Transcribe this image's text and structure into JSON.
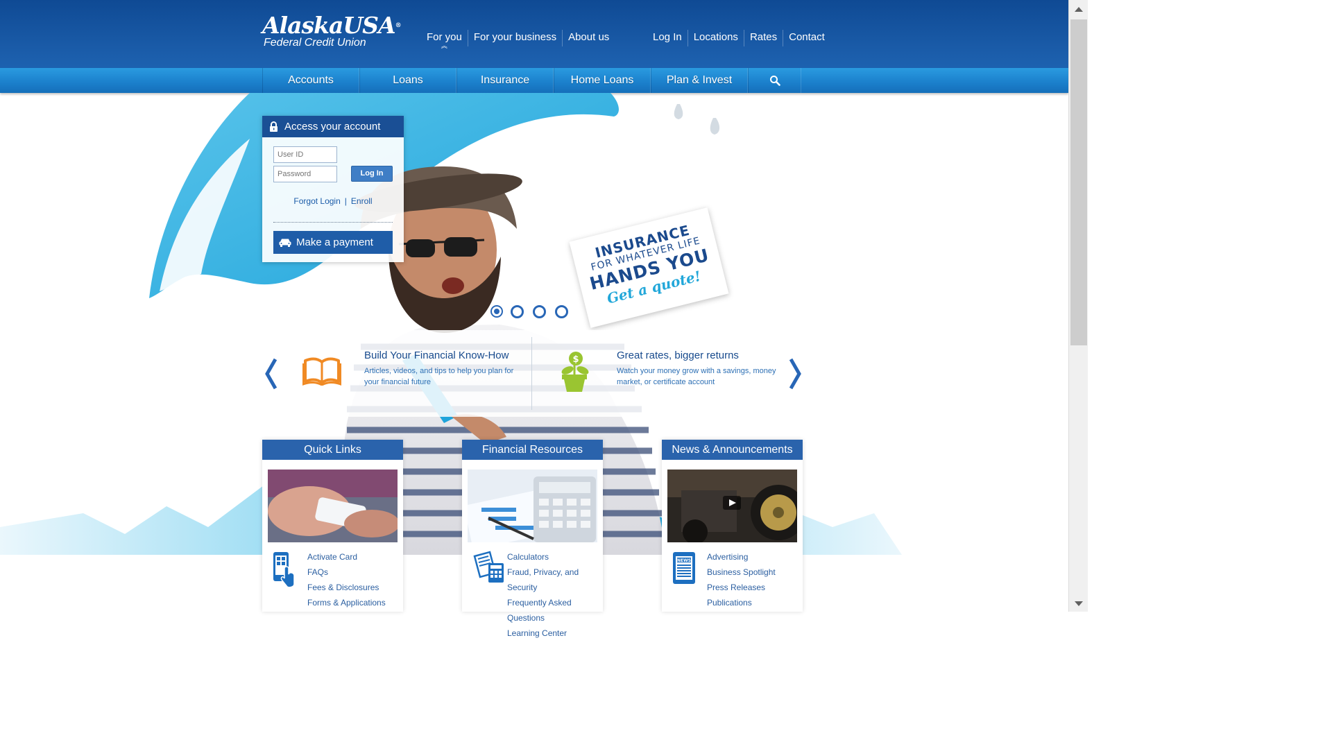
{
  "brand": {
    "name_line1": "AlaskaUSA",
    "name_mark": "®",
    "name_line2": "Federal Credit Union",
    "primary_color": "#1a5ba8",
    "nav_color": "#1b7fcb",
    "accent_color": "#22a7d9"
  },
  "top_nav": {
    "left": [
      {
        "label": "For you",
        "active": true
      },
      {
        "label": "For your business"
      },
      {
        "label": "About us"
      }
    ],
    "right": [
      {
        "label": "Log In"
      },
      {
        "label": "Locations"
      },
      {
        "label": "Rates"
      },
      {
        "label": "Contact"
      }
    ]
  },
  "main_nav": {
    "items": [
      {
        "label": "Accounts"
      },
      {
        "label": "Loans"
      },
      {
        "label": "Insurance"
      },
      {
        "label": "Home Loans"
      },
      {
        "label": "Plan & Invest"
      }
    ],
    "search_icon": "search-icon"
  },
  "login": {
    "title": "Access your account",
    "user_placeholder": "User ID",
    "password_placeholder": "Password",
    "login_button": "Log In",
    "forgot_link": "Forgot Login",
    "separator": "|",
    "enroll_link": "Enroll",
    "payment_button": "Make a payment"
  },
  "hero_card": {
    "line1": "INSURANCE",
    "line2": "FOR WHATEVER LIFE",
    "line3": "HANDS YOU",
    "line4": "Get a quote!"
  },
  "carousel": {
    "slides": 4,
    "active": 1
  },
  "promo": {
    "left": {
      "title": "Build Your Financial Know-How",
      "desc": "Articles, videos, and tips to help you plan for your financial future",
      "icon": "book-icon"
    },
    "right": {
      "title": "Great rates, bigger returns",
      "desc": "Watch your money grow with a savings, money market, or certificate account",
      "icon": "money-plant-icon"
    }
  },
  "cards": [
    {
      "title": "Quick Links",
      "items": [
        "Activate Card",
        "FAQs",
        "Fees & Disclosures",
        "Forms & Applications"
      ]
    },
    {
      "title": "Financial Resources",
      "items": [
        "Calculators",
        "Fraud, Privacy, and Security",
        "Frequently Asked Questions",
        "Learning Center"
      ]
    },
    {
      "title": "News & Announcements",
      "items": [
        "Advertising",
        "Business Spotlight",
        "Press Releases",
        "Publications"
      ]
    }
  ]
}
